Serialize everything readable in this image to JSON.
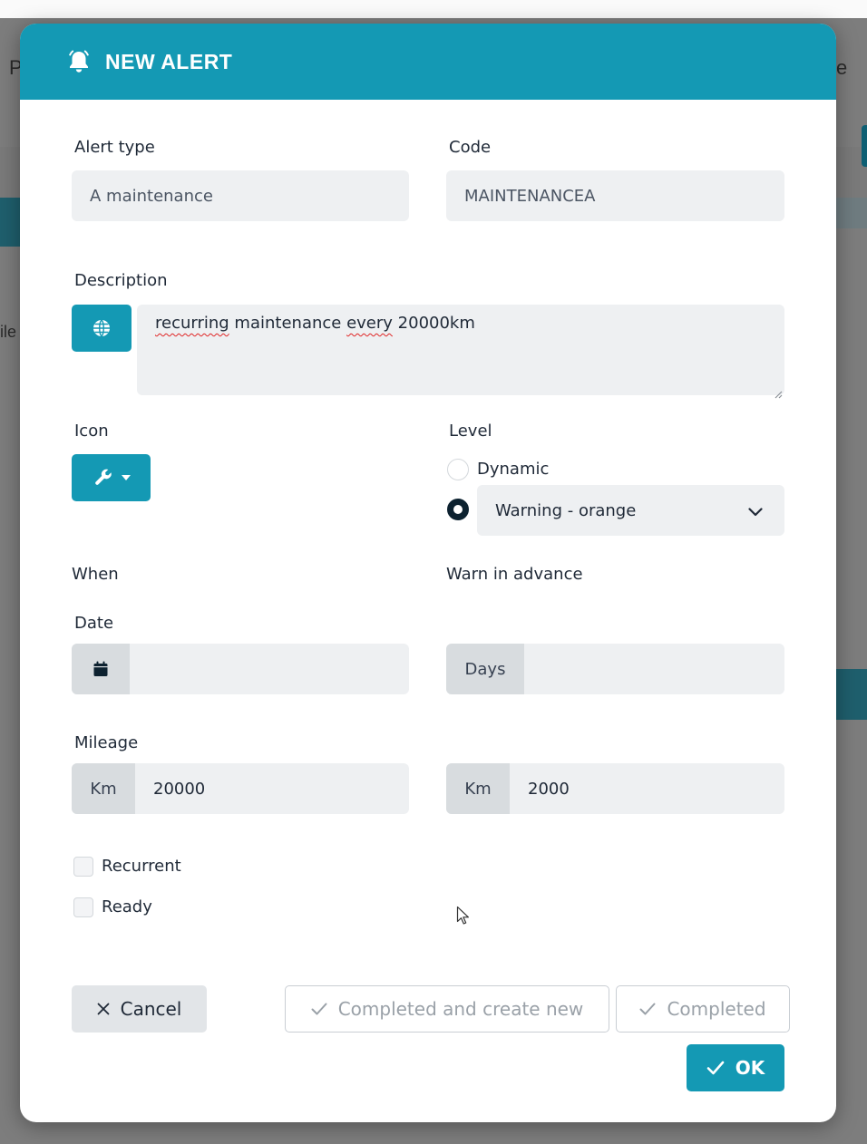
{
  "background": {
    "fragment_left_1": "P",
    "fragment_left_2": "ile",
    "fragment_right_1": "e"
  },
  "modal": {
    "title": "NEW ALERT",
    "header_icon": "bell-icon",
    "accent_color": "#1499b4"
  },
  "form": {
    "alert_type": {
      "label": "Alert type",
      "value": "A maintenance"
    },
    "code": {
      "label": "Code",
      "value": "MAINTENANCEA"
    },
    "description": {
      "label": "Description",
      "language_icon": "globe-icon",
      "word_1": "recurring",
      "text_2": " maintenance ",
      "word_3": "every",
      "text_4": " 20000km"
    },
    "icon": {
      "label": "Icon",
      "selected_icon": "wrench-icon"
    },
    "level": {
      "label": "Level",
      "option_dynamic": "Dynamic",
      "selected": "Warning - orange"
    },
    "when": {
      "label": "When"
    },
    "warn_in_advance": {
      "label": "Warn in advance"
    },
    "date": {
      "label": "Date",
      "value": ""
    },
    "days": {
      "addon": "Days",
      "value": ""
    },
    "mileage": {
      "label": "Mileage",
      "addon": "Km",
      "value": "20000"
    },
    "mileage_advance": {
      "addon": "Km",
      "value": "2000"
    },
    "recurrent": {
      "label": "Recurrent",
      "checked": false
    },
    "ready": {
      "label": "Ready",
      "checked": false
    }
  },
  "buttons": {
    "cancel": "Cancel",
    "completed_create_new": "Completed and create new",
    "completed": "Completed",
    "ok": "OK"
  }
}
